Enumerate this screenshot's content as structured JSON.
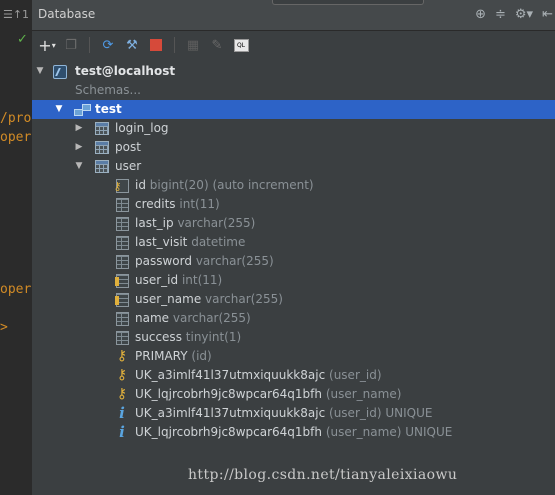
{
  "gutter": {
    "top_label": "☰↑1",
    "code_lines": [
      "/pro",
      "oper",
      "oper",
      ">"
    ]
  },
  "panel": {
    "title": "Database",
    "title_icons": [
      "target-icon",
      "collapse-icon",
      "gear-icon",
      "hide-icon"
    ]
  },
  "toolbar": {
    "buttons": [
      "add-icon",
      "copy-icon",
      "refresh-icon",
      "sync-icon",
      "stop-icon",
      "table-icon",
      "edit-icon",
      "console-icon"
    ]
  },
  "tree": {
    "datasource": {
      "label": "test@localhost"
    },
    "schemas_label": "Schemas...",
    "schema": {
      "label": "test"
    },
    "tables": [
      {
        "name": "login_log",
        "expanded": false
      },
      {
        "name": "post",
        "expanded": false
      },
      {
        "name": "user",
        "expanded": true
      }
    ],
    "columns": [
      {
        "name": "id",
        "type": "bigint(20) (auto increment)",
        "kind": "pk"
      },
      {
        "name": "credits",
        "type": "int(11)",
        "kind": "col"
      },
      {
        "name": "last_ip",
        "type": "varchar(255)",
        "kind": "col"
      },
      {
        "name": "last_visit",
        "type": "datetime",
        "kind": "col"
      },
      {
        "name": "password",
        "type": "varchar(255)",
        "kind": "col"
      },
      {
        "name": "user_id",
        "type": "int(11)",
        "kind": "fk"
      },
      {
        "name": "user_name",
        "type": "varchar(255)",
        "kind": "fk"
      },
      {
        "name": "name",
        "type": "varchar(255)",
        "kind": "col"
      },
      {
        "name": "success",
        "type": "tinyint(1)",
        "kind": "col"
      }
    ],
    "keys": [
      {
        "name": "PRIMARY",
        "detail": "(id)",
        "kind": "key"
      },
      {
        "name": "UK_a3imlf41l37utmxiquukk8ajc",
        "detail": "(user_id)",
        "kind": "key"
      },
      {
        "name": "UK_lqjrcobrh9jc8wpcar64q1bfh",
        "detail": "(user_name)",
        "kind": "key"
      },
      {
        "name": "UK_a3imlf41l37utmxiquukk8ajc",
        "detail": "(user_id) UNIQUE",
        "kind": "index"
      },
      {
        "name": "UK_lqjrcobrh9jc8wpcar64q1bfh",
        "detail": "(user_name) UNIQUE",
        "kind": "index"
      }
    ]
  },
  "watermark": "http://blog.csdn.net/tianyaleixiaowu",
  "colors": {
    "selection": "#2d63c7",
    "panel_bg": "#3b3f41",
    "key": "#e0b03c",
    "index": "#5aa5e0",
    "code": "#d28b26"
  }
}
